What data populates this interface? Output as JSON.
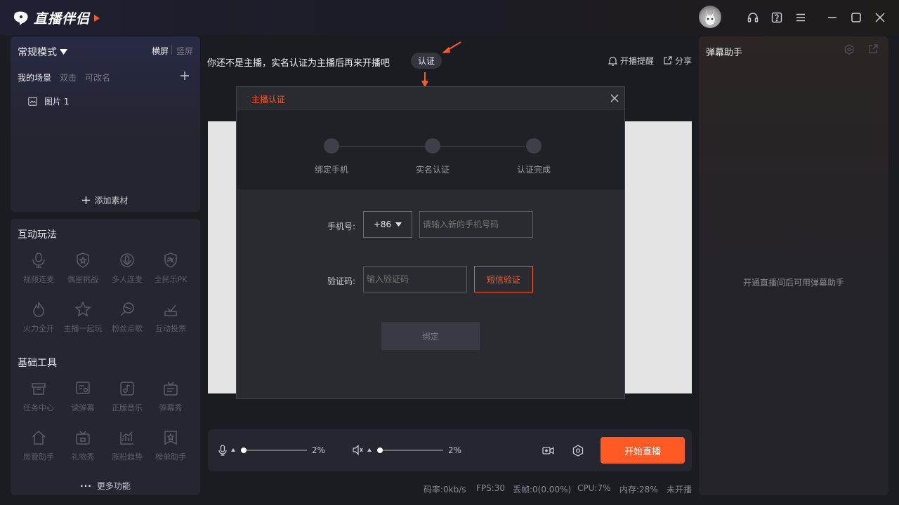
{
  "app": {
    "title": "直播伴侣"
  },
  "scene_panel": {
    "mode_label": "常规模式",
    "orientation_landscape": "横屏",
    "orientation_portrait": "竖屏",
    "scenes_label": "我的场景",
    "scenes_hint1": "双击",
    "scenes_hint2": "可改名",
    "scene_items": [
      "图片 1"
    ],
    "add_material": "添加素材"
  },
  "interactive": {
    "title": "互动玩法",
    "items": [
      "视频连麦",
      "偶星挑战",
      "多人连麦",
      "全民乐PK",
      "火力全开",
      "主播一起玩",
      "粉丝点歌",
      "互动投票"
    ]
  },
  "basic_tools": {
    "title": "基础工具",
    "items": [
      "任务中心",
      "读弹幕",
      "正版音乐",
      "弹幕秀",
      "房管助手",
      "礼物秀",
      "涨粉趋势",
      "榜单助手"
    ],
    "more": "更多功能"
  },
  "notice": {
    "text": "你还不是主播，实名认证为主播后再来开播吧",
    "verify_button": "认证",
    "remind": "开播提醒",
    "share": "分享"
  },
  "modal": {
    "title": "主播认证",
    "steps": [
      "绑定手机",
      "实名认证",
      "认证完成"
    ],
    "phone_label": "手机号:",
    "country_code": "+86",
    "phone_placeholder": "请输入新的手机号码",
    "code_label": "验证码:",
    "code_placeholder": "输入验证码",
    "sms_button": "短信验证",
    "bind_button": "绑定"
  },
  "controls": {
    "mic_volume": "2%",
    "speaker_volume": "2%",
    "mic_level": 0,
    "speaker_level": 0,
    "start_live": "开始直播"
  },
  "status_bar": {
    "bitrate": "码率:0kb/s",
    "fps": "FPS:30",
    "dropped": "丢帧:0(0.00%)",
    "cpu": "CPU:7%",
    "memory": "内存:28%",
    "live_status": "未开播"
  },
  "danmu": {
    "title": "弹幕助手",
    "empty_text": "开通直播间后可用弹幕助手"
  },
  "colors": {
    "accent": "#ff5a23",
    "background": "#1b1c22",
    "panel": "#25262e"
  }
}
